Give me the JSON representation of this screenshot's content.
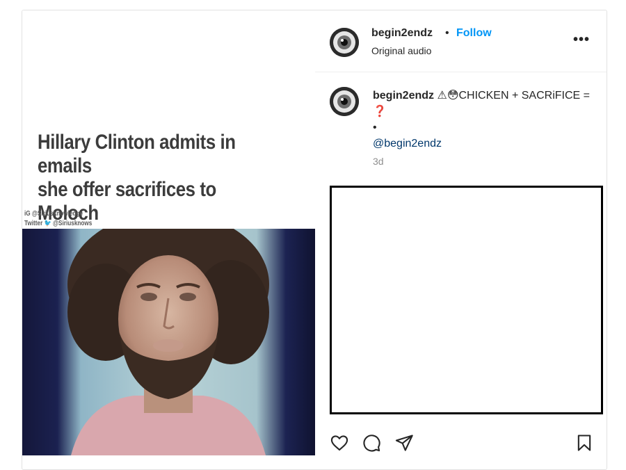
{
  "media": {
    "headline_line1": "Hillary Clinton admits in emails",
    "headline_line2": "she offer sacrifices to Moloch",
    "credit_ig": "iG @Siriusknowledge",
    "credit_twitter_prefix": "Twitter",
    "credit_twitter_handle": "@Siriusknows"
  },
  "header": {
    "username": "begin2endz",
    "separator": "•",
    "follow_label": "Follow",
    "audio_label": "Original audio",
    "more_label": "•••"
  },
  "caption": {
    "username": "begin2endz",
    "text_part1": "⚠😳CHICKEN + SACRiFICE = ",
    "question_emoji": "❓",
    "bullet": "•",
    "mention": "@begin2endz",
    "age": "3d"
  },
  "actions": {
    "icons": [
      "heart-icon",
      "comment-icon",
      "share-icon",
      "bookmark-icon"
    ]
  },
  "colors": {
    "accent": "#0095f6",
    "mention": "#00376b",
    "muted": "#8e8e8e",
    "text": "#262626"
  }
}
